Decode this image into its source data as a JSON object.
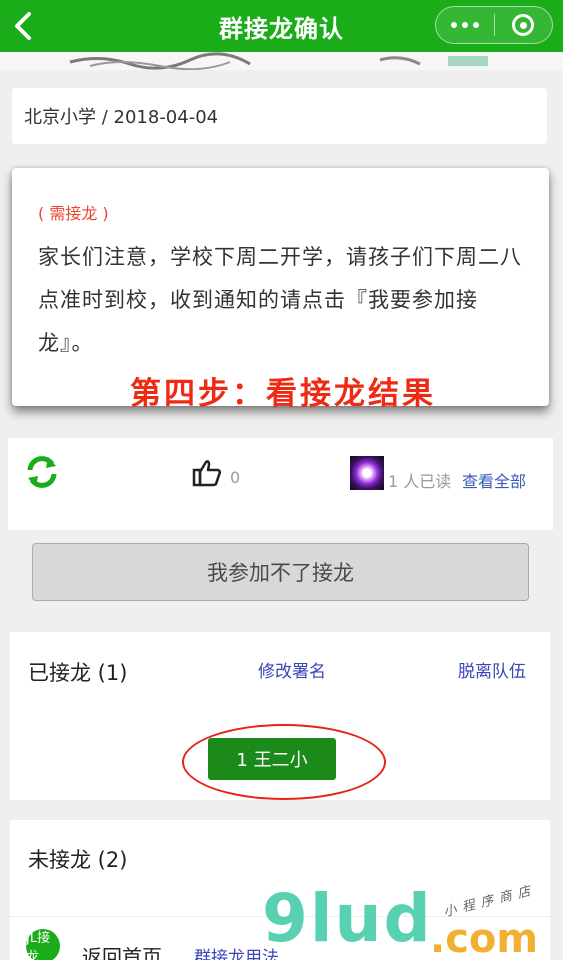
{
  "navbar": {
    "title": "群接龙确认",
    "back_icon": "chevron-left-icon",
    "menu_icon": "more-dots-icon",
    "close_icon": "target-close-icon",
    "bg_color": "#1aac19"
  },
  "school": {
    "text": "北京小学 / 2018-04-04"
  },
  "notice": {
    "tag": "( 需接龙 )",
    "text": "家长们注意，学校下周二开学，请孩子们下周二八点准时到校，收到通知的请点击『我要参加接龙』。"
  },
  "step_overlay": "第四步：看接龙结果",
  "stats": {
    "refresh_icon": "refresh-icon",
    "like_icon": "thumbs-up-icon",
    "like_count": "0",
    "read_text": "1 人已读",
    "see_all": "查看全部"
  },
  "cant_join_button": "我参加不了接龙",
  "joined": {
    "title": "已接龙 (1)",
    "edit_name": "修改署名",
    "leave": "脱离队伍",
    "members": [
      "1 王二小"
    ]
  },
  "not_joined": {
    "title": "未接龙 (2)"
  },
  "bottom": {
    "logo_text": "JL接龙",
    "back_home": "返回首页",
    "usage": "群接龙用法"
  },
  "watermark": {
    "main": "9lud",
    "suffix": ".com",
    "tag": "小程序商店"
  },
  "colors": {
    "accent_green": "#1aac19",
    "member_chip": "#1b8a1b",
    "link_blue": "#3a45b8",
    "highlight_red": "#ef2a14"
  }
}
